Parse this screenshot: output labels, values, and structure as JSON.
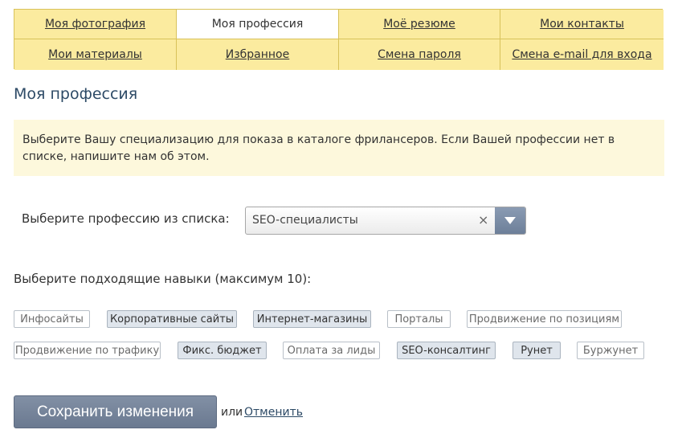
{
  "tabs": [
    {
      "label": "Моя фотография",
      "active": false
    },
    {
      "label": "Моя профессия",
      "active": true
    },
    {
      "label": "Моё резюме",
      "active": false
    },
    {
      "label": "Мои контакты",
      "active": false
    },
    {
      "label": "Мои материалы",
      "active": false
    },
    {
      "label": "Избранное",
      "active": false
    },
    {
      "label": "Смена пароля",
      "active": false
    },
    {
      "label": "Смена e-mail для входа",
      "active": false
    }
  ],
  "page_title": "Моя профессия",
  "info_text": "Выберите Вашу специализацию для показа в каталоге фрилансеров. Если Вашей профессии нет в списке, напишите нам об этом.",
  "profession_select": {
    "label": "Выберите профессию из списка:",
    "value": "SEO-специалисты",
    "clear_icon": "×"
  },
  "skills": {
    "label": "Выберите подходящие навыки (максимум 10):",
    "items": [
      {
        "label": "Инфосайты",
        "selected": false
      },
      {
        "label": "Корпоративные сайты",
        "selected": true
      },
      {
        "label": "Интернет-магазины",
        "selected": true
      },
      {
        "label": "Порталы",
        "selected": false
      },
      {
        "label": "Продвижение по позициям",
        "selected": false
      },
      {
        "label": "Продвижение по трафику",
        "selected": false
      },
      {
        "label": "Фикс. бюджет",
        "selected": true
      },
      {
        "label": "Оплата за лиды",
        "selected": false
      },
      {
        "label": "SEO-консалтинг",
        "selected": true
      },
      {
        "label": "Рунет",
        "selected": true
      },
      {
        "label": "Буржунет",
        "selected": false
      }
    ]
  },
  "actions": {
    "save_label": "Сохранить изменения",
    "or_text": "или",
    "cancel_label": "Отменить"
  },
  "colors": {
    "tab_bg": "#fbeb9f",
    "tab_border": "#d8c25a",
    "info_bg": "#fdf8dc",
    "title": "#2d4a66",
    "button": "#76849a",
    "chip_selected_bg": "#dfe5ec"
  }
}
